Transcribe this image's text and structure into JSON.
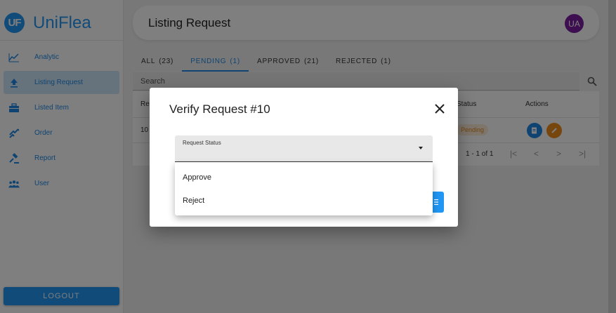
{
  "app": {
    "name": "UniFlea",
    "logo_text": "UF"
  },
  "sidebar": {
    "items": [
      {
        "label": "Analytic",
        "icon": "chart-line-icon",
        "active": false
      },
      {
        "label": "Listing Request",
        "icon": "upload-icon",
        "active": true
      },
      {
        "label": "Listed Item",
        "icon": "inventory-icon",
        "active": false
      },
      {
        "label": "Order",
        "icon": "exchange-icon",
        "active": false
      },
      {
        "label": "Report",
        "icon": "gavel-icon",
        "active": false
      },
      {
        "label": "User",
        "icon": "people-icon",
        "active": false
      }
    ],
    "logout_label": "LOGOUT"
  },
  "header": {
    "title": "Listing Request",
    "avatar_initials": "UA"
  },
  "tabs": [
    {
      "label": "ALL",
      "count": "(23)",
      "active": false
    },
    {
      "label": "PENDING",
      "count": "(1)",
      "active": true
    },
    {
      "label": "APPROVED",
      "count": "(21)",
      "active": false
    },
    {
      "label": "REJECTED",
      "count": "(1)",
      "active": false
    }
  ],
  "search": {
    "placeholder": "Search"
  },
  "table": {
    "columns": {
      "id": "Re",
      "status": "Status",
      "actions": "Actions"
    },
    "rows": [
      {
        "id": "10",
        "status": "Pending"
      }
    ],
    "pagination": "1 - 1 of 1"
  },
  "modal": {
    "title": "Verify Request #10",
    "select_label": "Request Status",
    "options": [
      "Approve",
      "Reject"
    ]
  },
  "colors": {
    "primary": "#2196f3",
    "avatar": "#7b1fa2",
    "pending_badge_bg": "#fdebd6",
    "pending_badge_text": "#e08a1e",
    "view_action": "#1e88e5",
    "edit_action": "#ef8c1a"
  }
}
